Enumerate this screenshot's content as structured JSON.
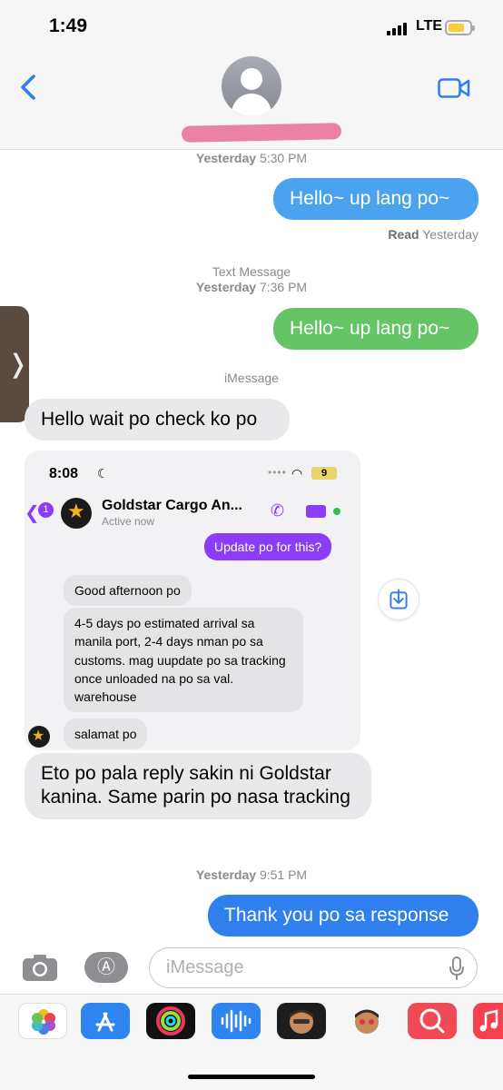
{
  "status_bar": {
    "time": "1:49",
    "network": "LTE"
  },
  "header": {
    "contact_name": ""
  },
  "conversation": {
    "stamp1": {
      "day": "Yesterday",
      "time": "5:30 PM"
    },
    "msg1": "Hello~ up lang po~",
    "read_receipt": {
      "label": "Read",
      "when": "Yesterday"
    },
    "stamp2": {
      "service": "Text Message",
      "day": "Yesterday",
      "time": "7:36 PM"
    },
    "msg2": "Hello~ up lang po~",
    "service_label": "iMessage",
    "msg3": "Hello wait po check ko po",
    "msg4": "Eto po pala reply sakin ni Goldstar kanina. Same parin po nasa tracking",
    "stamp3": {
      "day": "Yesterday",
      "time": "9:51 PM"
    },
    "msg5": "Thank you po sa response"
  },
  "embedded_screenshot": {
    "time": "8:08",
    "battery": "9",
    "back_badge": "1",
    "contact": "Goldstar Cargo An...",
    "status": "Active now",
    "outgoing": "Update po for this?",
    "incoming": [
      "Good afternoon po",
      "4-5 days po estimated arrival sa manila port, 2-4 days nman po sa customs. mag uupdate po sa tracking once unloaded na po sa val. warehouse",
      "salamat po"
    ]
  },
  "input_bar": {
    "placeholder": "iMessage"
  },
  "app_drawer": {
    "apps": [
      "photos-app-icon",
      "app-store-icon",
      "fitness-icon",
      "audio-message-icon",
      "memoji-icon",
      "memoji-stickers-icon",
      "web-search-icon",
      "music-icon"
    ]
  },
  "colors": {
    "imessage_blue": "#2f80ed",
    "sms_green": "#65c466",
    "received_gray": "#e9e9eb",
    "messenger_purple": "#8b3cf6"
  }
}
